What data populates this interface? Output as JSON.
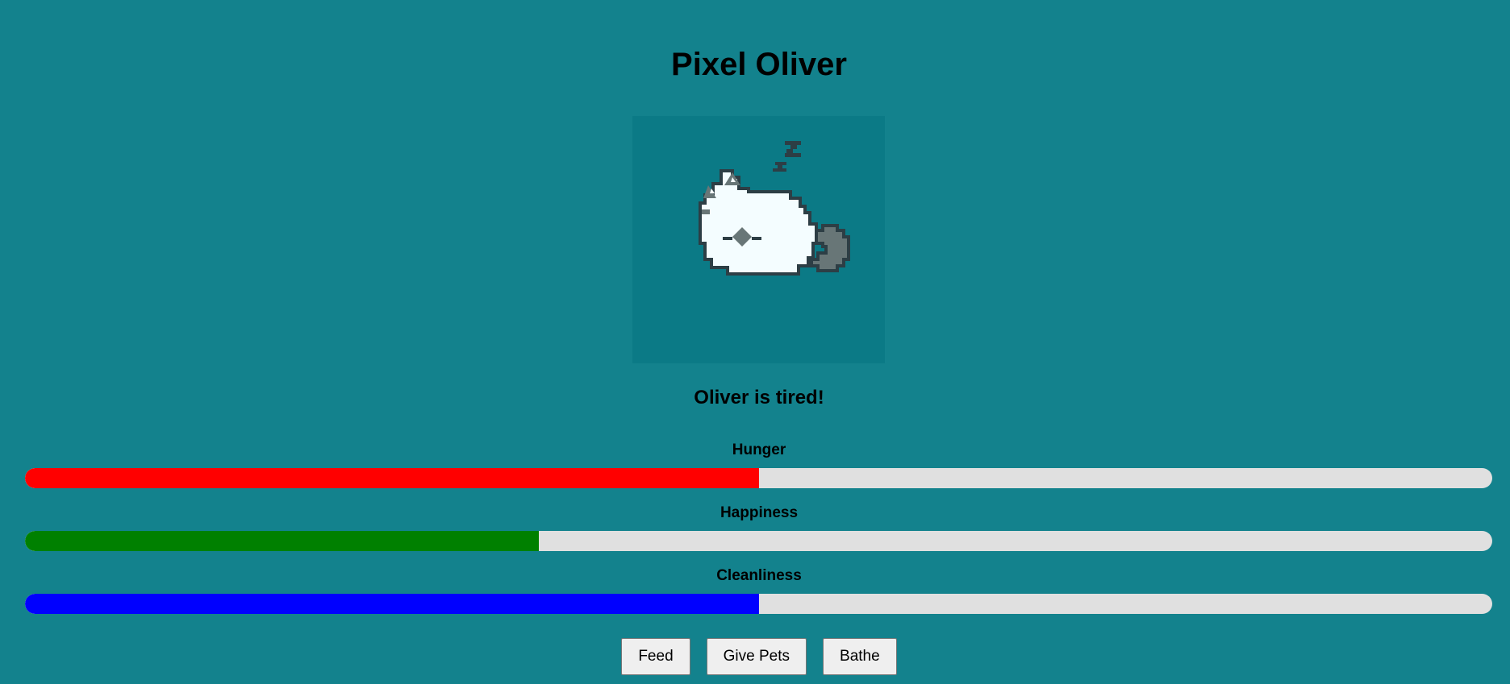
{
  "app": {
    "title": "Pixel Oliver",
    "status_message": "Oliver is tired!"
  },
  "pet": {
    "state": "sleeping",
    "sleep_icon": "zzz-icon"
  },
  "stats": [
    {
      "label": "Hunger",
      "value": 0.5,
      "color": "#ff0000"
    },
    {
      "label": "Happiness",
      "value": 0.35,
      "color": "#008000"
    },
    {
      "label": "Cleanliness",
      "value": 0.5,
      "color": "#0000ff"
    }
  ],
  "actions": {
    "feed_label": "Feed",
    "pet_label": "Give Pets",
    "bathe_label": "Bathe"
  },
  "colors": {
    "background": "#13828d",
    "bar_track": "#e0e0e0"
  }
}
